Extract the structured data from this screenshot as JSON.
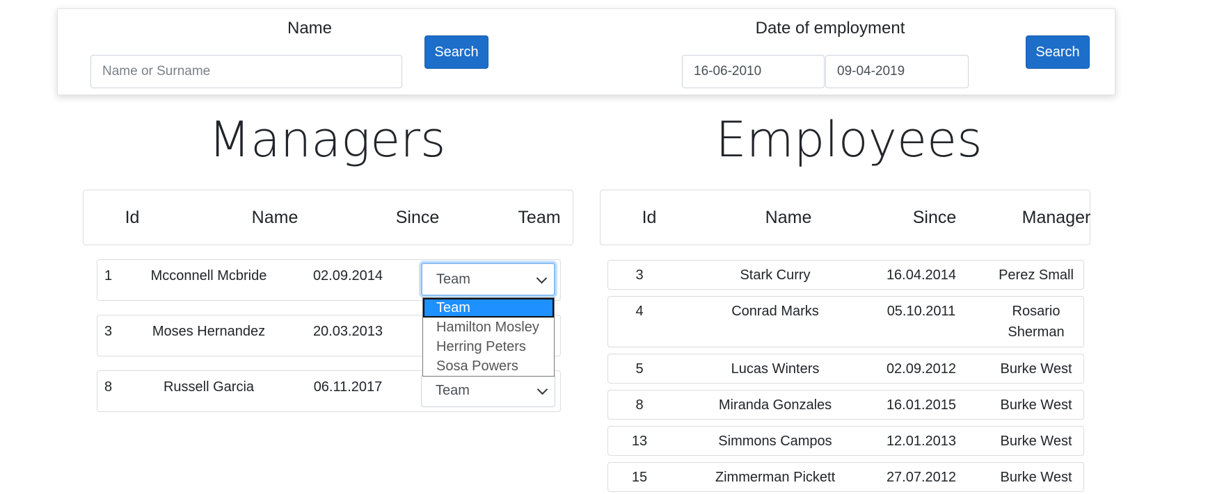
{
  "search": {
    "name_label": "Name",
    "name_placeholder": "Name or Surname",
    "name_button": "Search",
    "date_label": "Date of employment",
    "date_from": "16-06-2010",
    "date_to": "09-04-2019",
    "date_button": "Search"
  },
  "managers": {
    "title": "Managers",
    "headers": [
      "Id",
      "Name",
      "Since",
      "Team"
    ],
    "rows": [
      {
        "id": "1",
        "name": "Mcconnell Mcbride",
        "since": "02.09.2014",
        "team": "Team"
      },
      {
        "id": "3",
        "name": "Moses Hernandez",
        "since": "20.03.2013",
        "team": "Team"
      },
      {
        "id": "8",
        "name": "Russell Garcia",
        "since": "06.11.2017",
        "team": "Team"
      }
    ],
    "dropdown_options": [
      "Team",
      "Hamilton Mosley",
      "Herring Peters",
      "Sosa Powers"
    ]
  },
  "employees": {
    "title": "Employees",
    "headers": [
      "Id",
      "Name",
      "Since",
      "Manager"
    ],
    "rows": [
      {
        "id": "3",
        "name": "Stark Curry",
        "since": "16.04.2014",
        "manager": "Perez Small"
      },
      {
        "id": "4",
        "name": "Conrad Marks",
        "since": "05.10.2011",
        "manager_line1": "Rosario",
        "manager_line2": "Sherman"
      },
      {
        "id": "5",
        "name": "Lucas Winters",
        "since": "02.09.2012",
        "manager": "Burke West"
      },
      {
        "id": "8",
        "name": "Miranda Gonzales",
        "since": "16.01.2015",
        "manager": "Burke West"
      },
      {
        "id": "13",
        "name": "Simmons Campos",
        "since": "12.01.2013",
        "manager": "Burke West"
      },
      {
        "id": "15",
        "name": "Zimmerman Pickett",
        "since": "27.07.2012",
        "manager": "Burke West"
      }
    ]
  }
}
